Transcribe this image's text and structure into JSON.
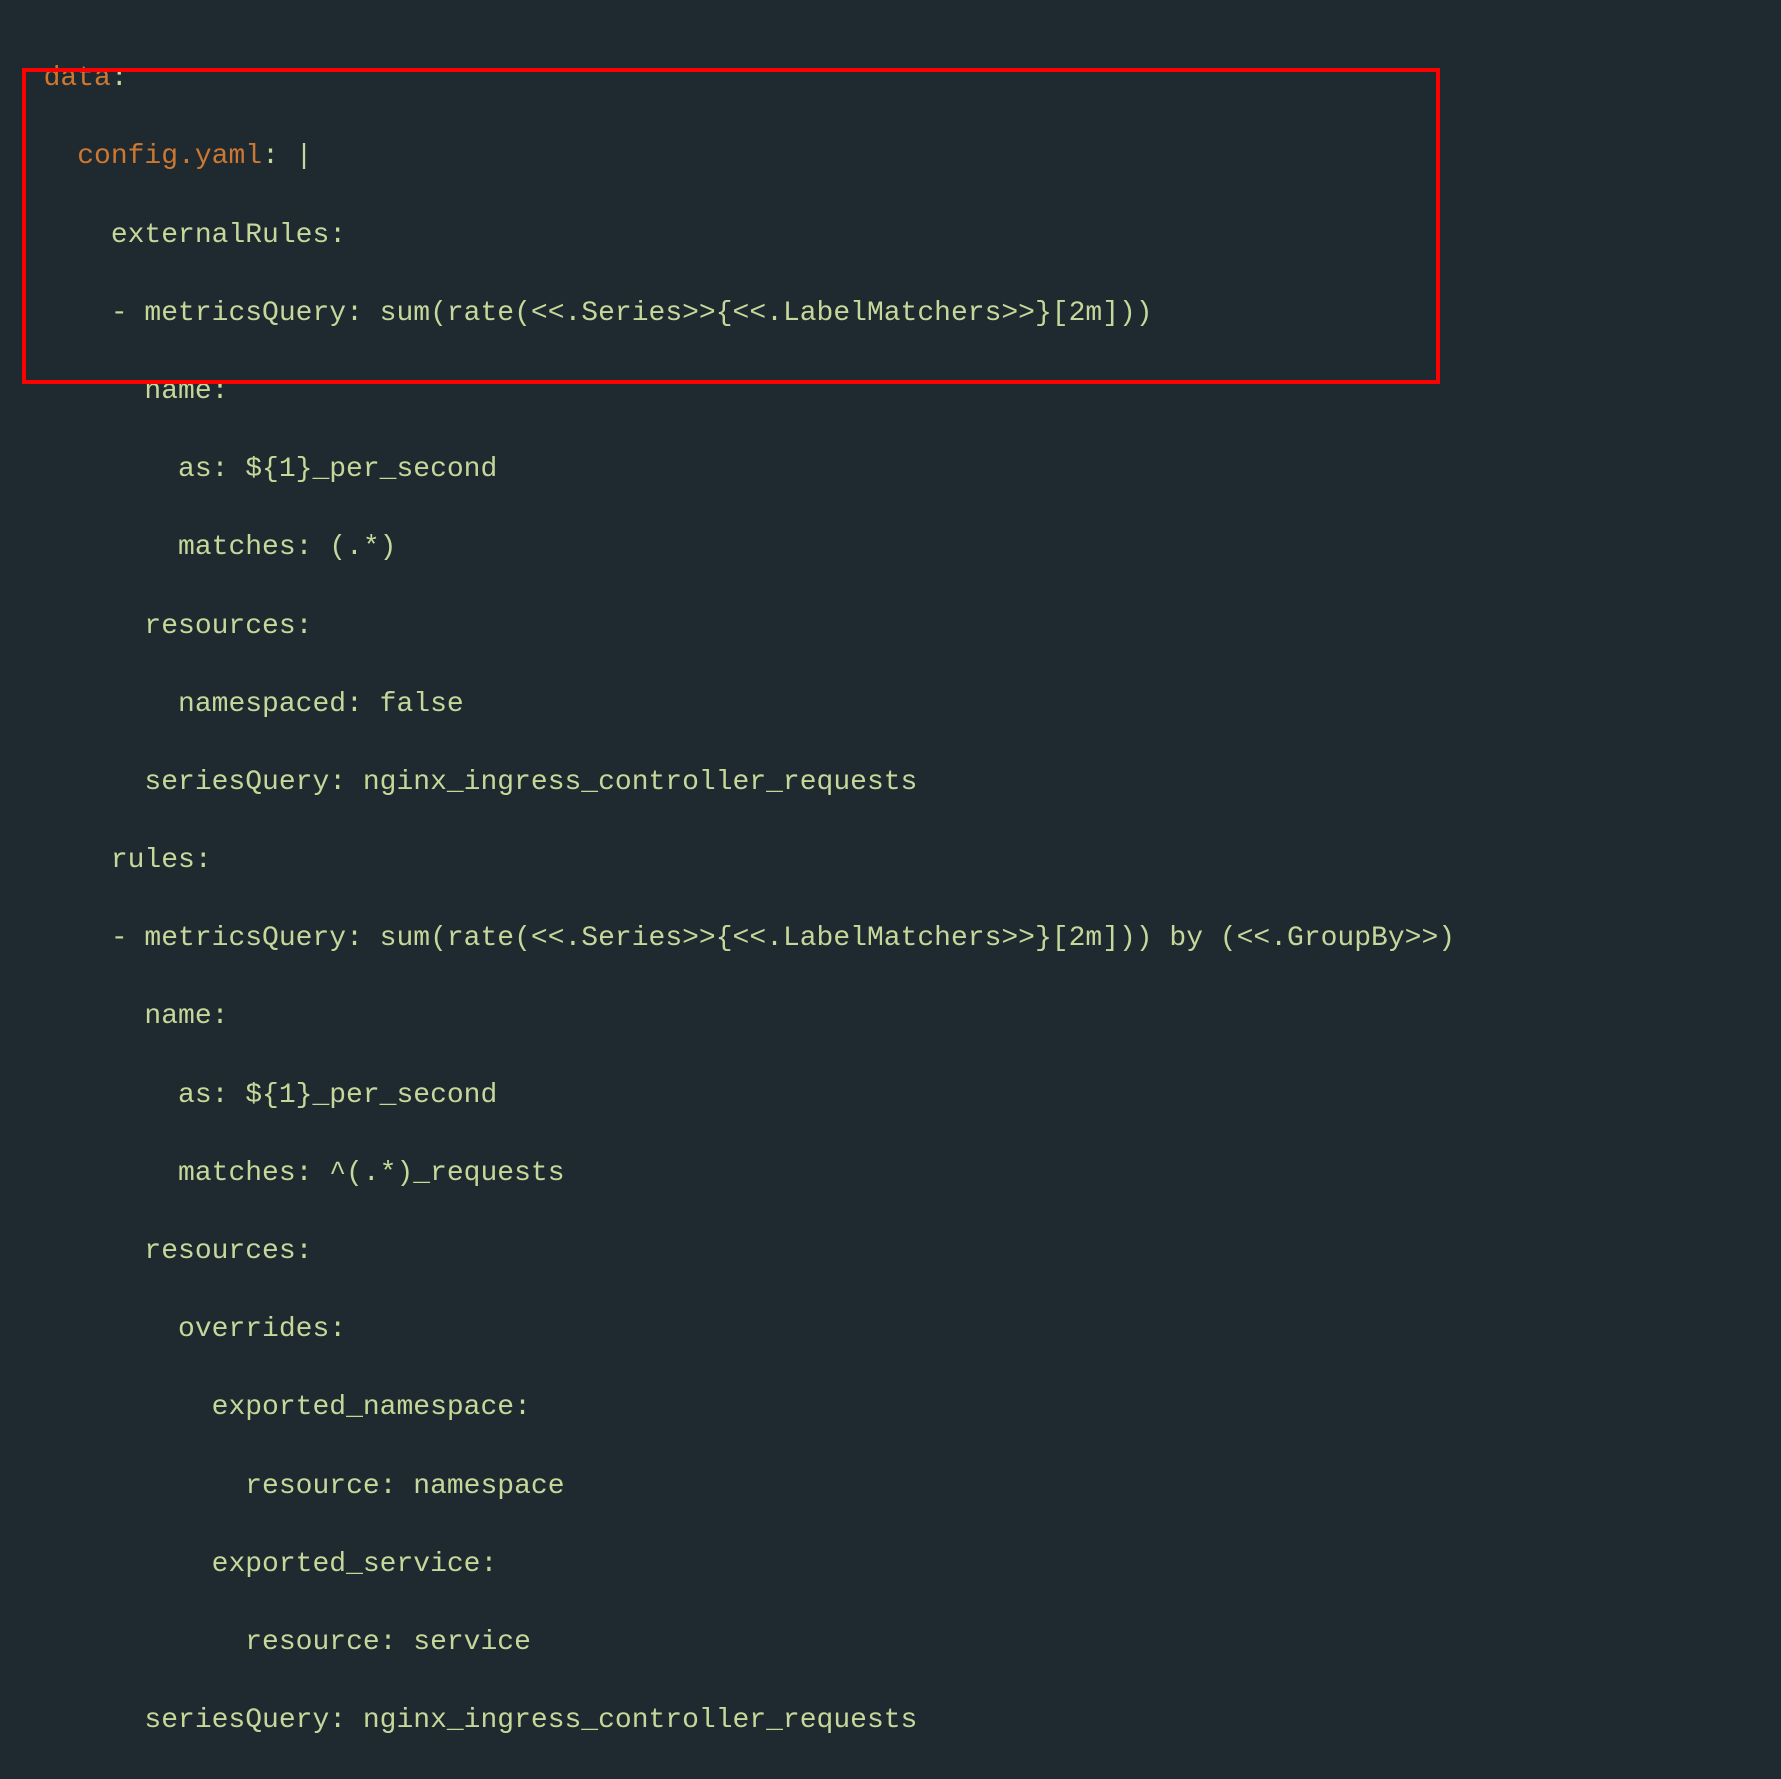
{
  "code": {
    "lines": [
      {
        "indent": 1,
        "key": "data",
        "after": ":"
      },
      {
        "indent": 2,
        "key": "config.yaml",
        "after": ": |"
      },
      {
        "indent": 3,
        "text": "externalRules:"
      },
      {
        "indent": 3,
        "text": "- metricsQuery: sum(rate(<<.Series>>{<<.LabelMatchers>>}[2m]))"
      },
      {
        "indent": 4,
        "text": "name:"
      },
      {
        "indent": 5,
        "text": "as: ${1}_per_second"
      },
      {
        "indent": 5,
        "text": "matches: (.*)"
      },
      {
        "indent": 4,
        "text": "resources:"
      },
      {
        "indent": 5,
        "text": "namespaced: false"
      },
      {
        "indent": 4,
        "text": "seriesQuery: nginx_ingress_controller_requests"
      },
      {
        "indent": 3,
        "text": "rules:"
      },
      {
        "indent": 3,
        "text": "- metricsQuery: sum(rate(<<.Series>>{<<.LabelMatchers>>}[2m])) by (<<.GroupBy>>)"
      },
      {
        "indent": 4,
        "text": "name:"
      },
      {
        "indent": 5,
        "text": "as: ${1}_per_second"
      },
      {
        "indent": 5,
        "text": "matches: ^(.*)_requests"
      },
      {
        "indent": 4,
        "text": "resources:"
      },
      {
        "indent": 5,
        "text": "overrides:"
      },
      {
        "indent": 6,
        "text": "exported_namespace:"
      },
      {
        "indent": 7,
        "text": "resource: namespace"
      },
      {
        "indent": 6,
        "text": "exported_service:"
      },
      {
        "indent": 7,
        "text": "resource: service"
      },
      {
        "indent": 4,
        "text": "seriesQuery: nginx_ingress_controller_requests"
      }
    ],
    "l1_key": "data",
    "l1_after": ":",
    "l2_key": "config.yaml",
    "l2_after": ": |",
    "l3": "externalRules:",
    "l4": "- metricsQuery: sum(rate(<<.Series>>{<<.LabelMatchers>>}[2m]))",
    "l5": "name:",
    "l6": "as: ${1}_per_second",
    "l7": "matches: (.*)",
    "l8": "resources:",
    "l9": "namespaced: false",
    "l10": "seriesQuery: nginx_ingress_controller_requests",
    "l11": "rules:",
    "l12": "- metricsQuery: sum(rate(<<.Series>>{<<.LabelMatchers>>}[2m])) by (<<.GroupBy>>)",
    "l13": "name:",
    "l14": "as: ${1}_per_second",
    "l15": "matches: ^(.*)_requests",
    "l16": "resources:",
    "l17": "overrides:",
    "l18": "exported_namespace:",
    "l19": "resource: namespace",
    "l20": "exported_service:",
    "l21": "resource: service",
    "l22": "seriesQuery: nginx_ingress_controller_requests"
  }
}
